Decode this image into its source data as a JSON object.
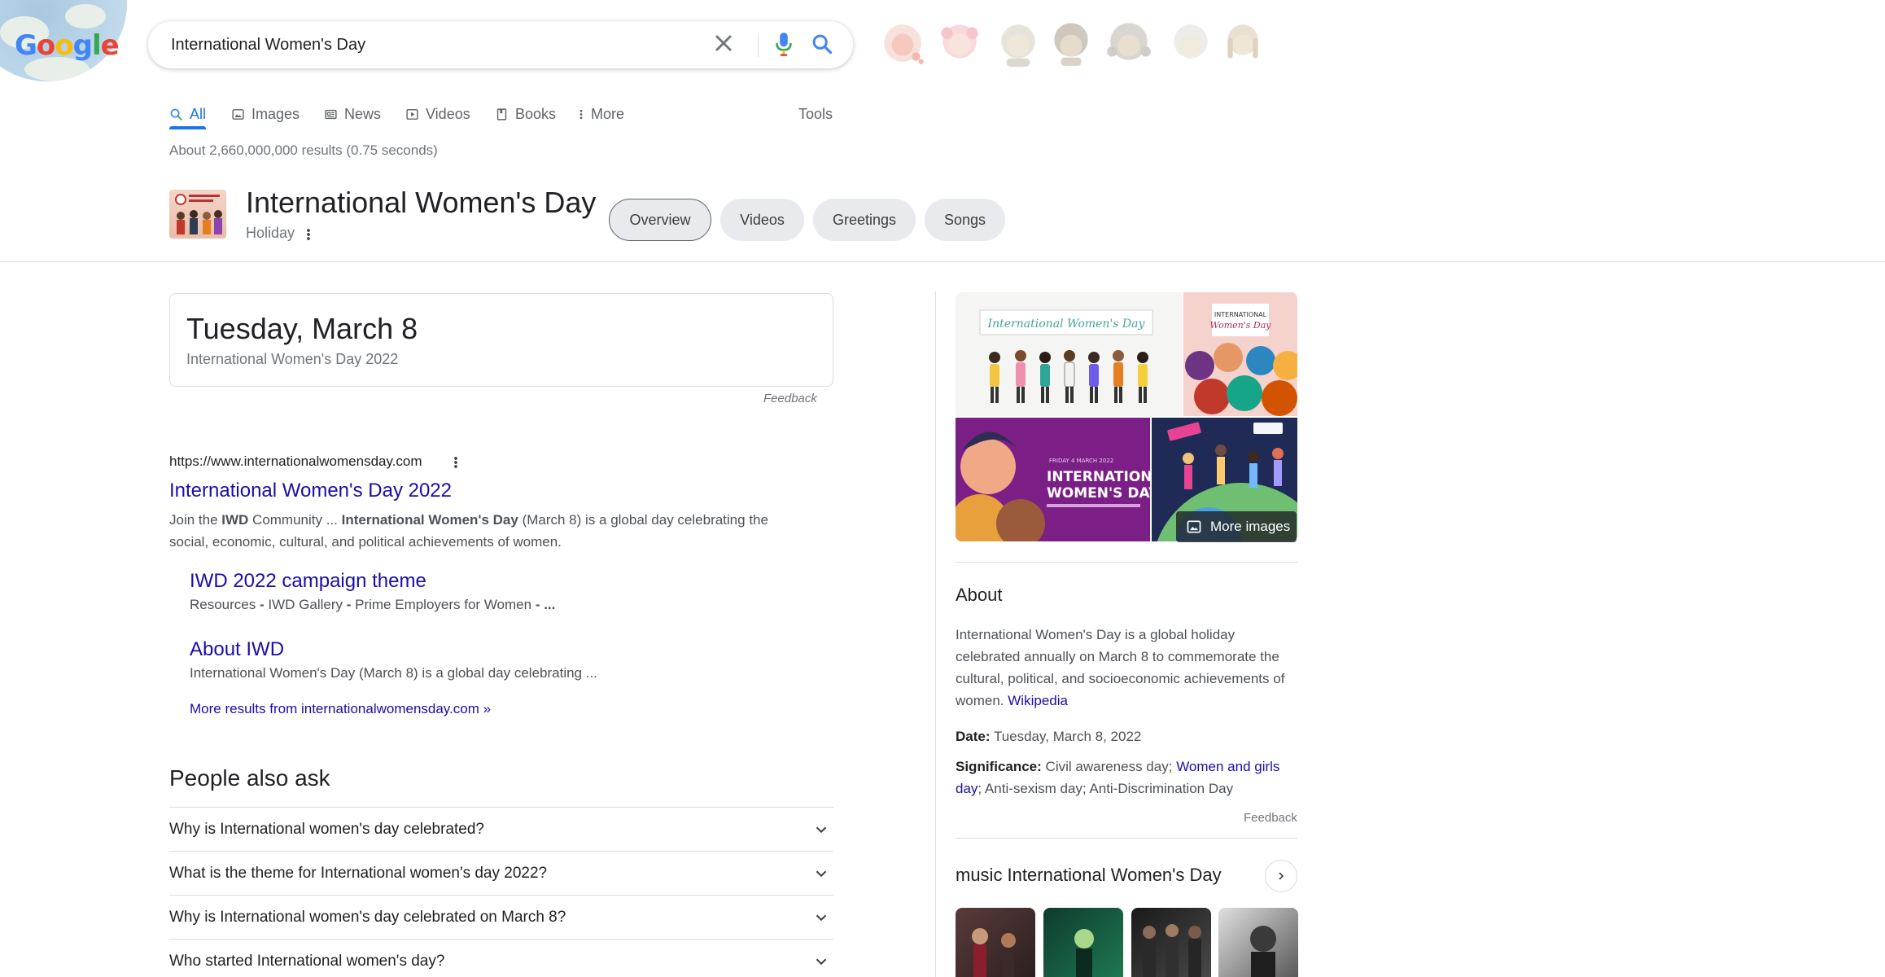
{
  "search": {
    "query": "International Women's Day",
    "logo_letters": [
      "G",
      "o",
      "o",
      "g",
      "l",
      "e"
    ]
  },
  "tabs": [
    {
      "label": "All",
      "icon": "search-icon",
      "active": true
    },
    {
      "label": "Images",
      "icon": "image-icon"
    },
    {
      "label": "News",
      "icon": "news-icon"
    },
    {
      "label": "Videos",
      "icon": "video-icon"
    },
    {
      "label": "Books",
      "icon": "book-icon"
    },
    {
      "label": "More",
      "icon": "more-vert-icon"
    }
  ],
  "tools_label": "Tools",
  "result_stats": "About 2,660,000,000 results (0.75 seconds)",
  "entity": {
    "title": "International Women's Day",
    "subtitle": "Holiday",
    "chips": [
      "Overview",
      "Videos",
      "Greetings",
      "Songs"
    ]
  },
  "date_answer": {
    "main": "Tuesday, March 8",
    "sub": "International Women's Day 2022",
    "feedback": "Feedback"
  },
  "result": {
    "url": "https://www.internationalwomensday.com",
    "title": "International Women's Day 2022",
    "snippet_parts": [
      "Join the ",
      "IWD",
      " Community ... ",
      "International Women's Day",
      " (March 8) is a global day celebrating the social, economic, cultural, and political achievements of women."
    ],
    "sitelinks": [
      {
        "title": "IWD 2022 campaign theme",
        "desc_parts": [
          "Resources ",
          "-",
          " IWD Gallery ",
          "-",
          " Prime Employers for Women ",
          "- ..."
        ]
      },
      {
        "title": "About IWD",
        "desc": "International Women's Day (March 8) is a global day celebrating ..."
      }
    ],
    "more_results": "More results from internationalwomensday.com »"
  },
  "paa": {
    "title": "People also ask",
    "questions": [
      "Why is International women's day celebrated?",
      "What is the theme for International women's day 2022?",
      "Why is International women's day celebrated on March 8?",
      "Who started International women's day?"
    ]
  },
  "knowledge_panel": {
    "image_banner_text": "International Women's Day",
    "image_card_small_line1": "INTERNATIONAL",
    "image_card_small_line2": "Women's Day",
    "image_event_date": "FRIDAY 4 MARCH 2022",
    "image_event_line1": "INTERNATIONAL",
    "image_event_line2": "WOMEN'S DAY",
    "more_images": "More images",
    "about_title": "About",
    "about_desc": "International Women's Day is a global holiday celebrated annually on March 8 to commemorate the cultural, political, and socioeconomic achievements of women.",
    "about_source": "Wikipedia",
    "date_label": "Date:",
    "date_value": "Tuesday, March 8, 2022",
    "significance_label": "Significance:",
    "significance_text1": "Civil awareness day;",
    "significance_link": "Women and girls day",
    "significance_text2": "; Anti-sexism day; Anti-Discrimination Day",
    "feedback": "Feedback",
    "music_title": "music International Women's Day"
  },
  "colors": {
    "link": "#1a0dab",
    "accent": "#1a73e8",
    "muted": "#70757a"
  }
}
